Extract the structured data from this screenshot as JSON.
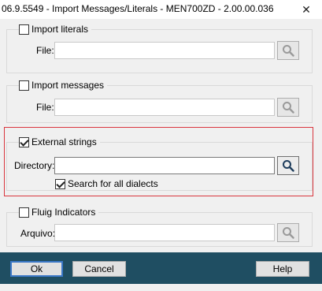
{
  "window": {
    "title": "06.9.5549 - Import Messages/Literals - MEN700ZD - 2.00.00.036",
    "close_glyph": "✕"
  },
  "import_literals": {
    "label": "Import literals",
    "checked": false,
    "field_label": "File:",
    "value": ""
  },
  "import_messages": {
    "label": "Import messages",
    "checked": false,
    "field_label": "File:",
    "value": ""
  },
  "external_strings": {
    "label": "External strings",
    "checked": true,
    "field_label": "Directory:",
    "value": "",
    "search_all_label": "Search for all dialects",
    "search_all_checked": true
  },
  "fluig_indicators": {
    "label": "Fluig Indicators",
    "checked": false,
    "field_label": "Arquivo:",
    "value": ""
  },
  "buttons": {
    "ok": "Ok",
    "cancel": "Cancel",
    "help": "Help"
  },
  "colors": {
    "footer": "#1f4e62",
    "highlight": "#d9363e",
    "search_icon_disabled": "#9a9a9a",
    "search_icon_active": "#1e3d5c"
  },
  "icons": {
    "search": "search-icon",
    "close": "close-icon"
  }
}
